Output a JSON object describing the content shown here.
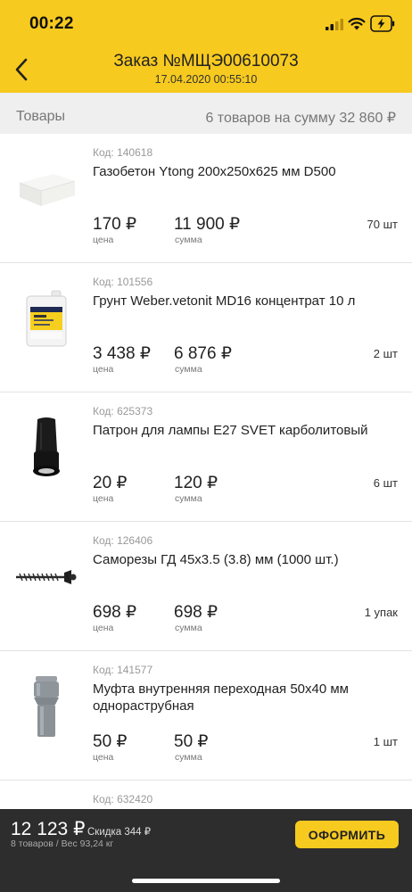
{
  "status_bar": {
    "time": "00:22"
  },
  "header": {
    "title": "Заказ №МЩЭ00610073",
    "subtitle": "17.04.2020 00:55:10",
    "accent_color": "#f7ca1f"
  },
  "summary": {
    "left": "Товары",
    "right": "6 товаров на сумму 32 860 ₽"
  },
  "items": [
    {
      "code": "Код: 140618",
      "name": "Газобетон Ytong 200x250x625 мм D500",
      "price": "170 ₽",
      "price_label": "цена",
      "sum": "11 900 ₽",
      "sum_label": "сумма",
      "qty": "70 шт",
      "icon": "aerated-block-icon"
    },
    {
      "code": "Код: 101556",
      "name": "Грунт Weber.vetonit MD16 концентрат 10 л",
      "price": "3 438 ₽",
      "price_label": "цена",
      "sum": "6 876 ₽",
      "sum_label": "сумма",
      "qty": "2 шт",
      "icon": "primer-canister-icon"
    },
    {
      "code": "Код: 625373",
      "name": "Патрон для лампы E27 SVET карболитовый",
      "price": "20 ₽",
      "price_label": "цена",
      "sum": "120 ₽",
      "sum_label": "сумма",
      "qty": "6 шт",
      "icon": "lamp-socket-icon"
    },
    {
      "code": "Код: 126406",
      "name": "Саморезы ГД 45x3.5 (3.8) мм (1000 шт.)",
      "price": "698 ₽",
      "price_label": "цена",
      "sum": "698 ₽",
      "sum_label": "сумма",
      "qty": "1 упак",
      "icon": "screw-icon"
    },
    {
      "code": "Код: 141577",
      "name": "Муфта внутренняя переходная 50x40 мм однораструбная",
      "price": "50 ₽",
      "price_label": "цена",
      "sum": "50 ₽",
      "sum_label": "сумма",
      "qty": "1 шт",
      "icon": "pipe-coupling-icon"
    },
    {
      "code": "Код: 632420",
      "name": "",
      "price": "",
      "price_label": "",
      "sum": "",
      "sum_label": "",
      "qty": "",
      "icon": ""
    }
  ],
  "footer": {
    "total": "12 123 ₽",
    "discount": "Скидка 344 ₽",
    "meta": "8 товаров / Вес 93,24 кг",
    "order_button": "ОФОРМИТЬ"
  }
}
